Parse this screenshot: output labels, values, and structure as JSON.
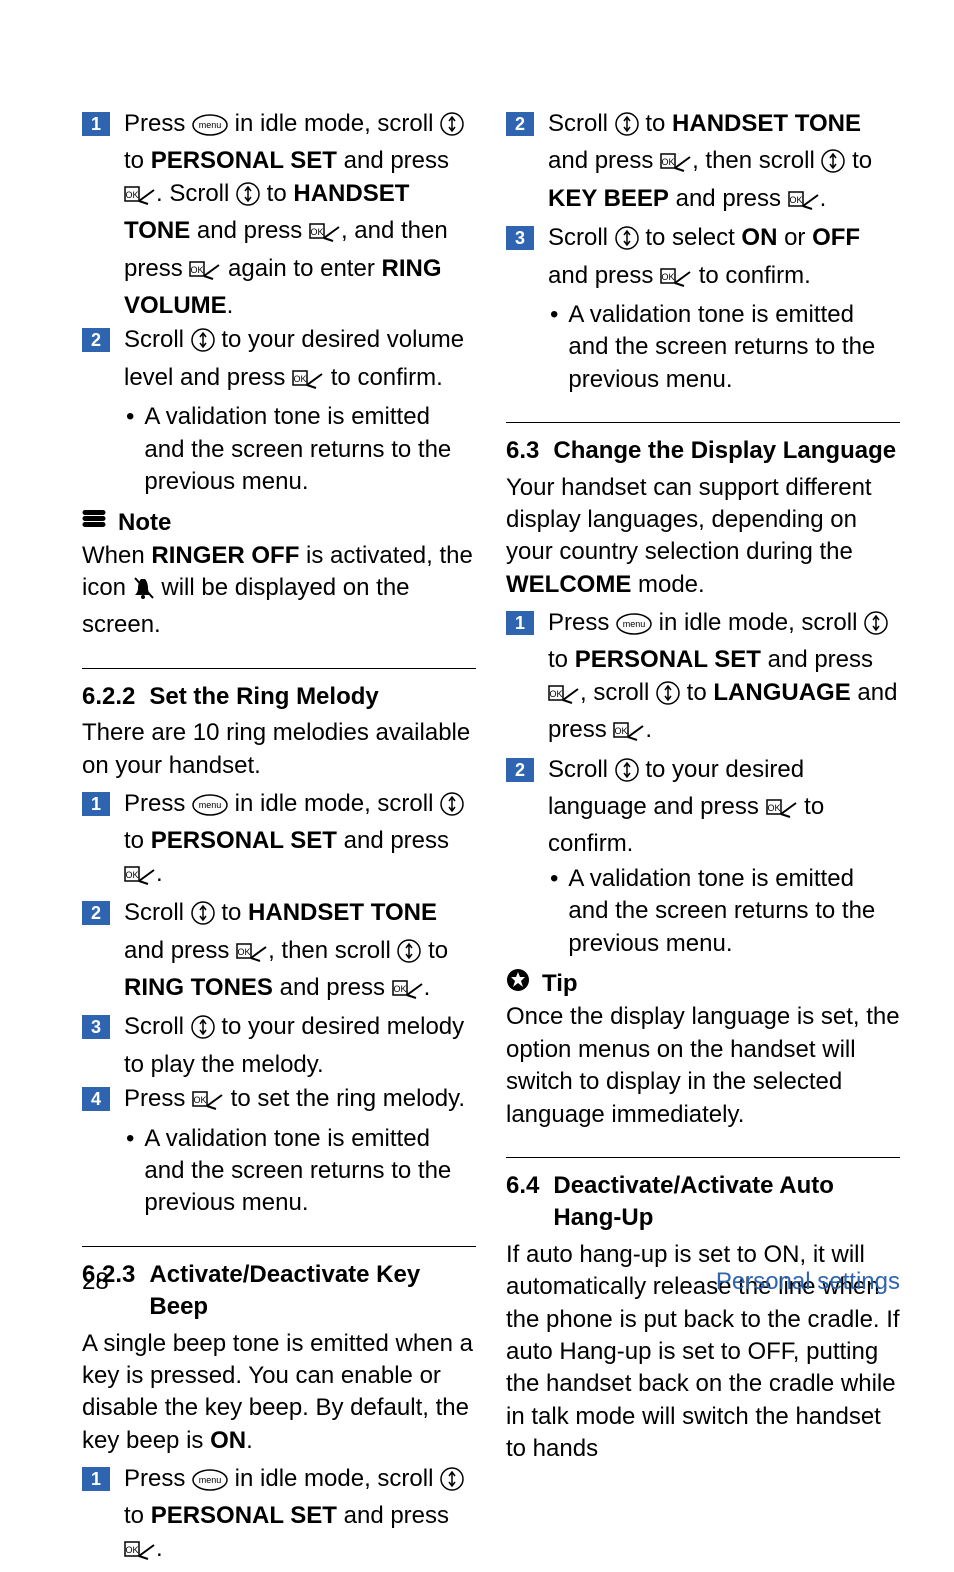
{
  "left": {
    "s1": {
      "a": "Press ",
      "b": " in idle mode, scroll ",
      "c": " to ",
      "d": "PERSONAL SET",
      "e": " and press ",
      "f": ". Scroll ",
      "g": " to ",
      "h": "HANDSET TONE",
      "i": " and press ",
      "j": ", and then press ",
      "k": " again to enter ",
      "l": "RING VOLUME",
      "m": "."
    },
    "s2": {
      "a": "Scroll ",
      "b": " to your desired volume level and press ",
      "c": " to confirm."
    },
    "bullet1": "A validation tone is emitted and the screen returns to the previous menu.",
    "noteLabel": "Note",
    "noteBody1": "When ",
    "noteBody2": "RINGER OFF",
    "noteBody3": " is activated, the icon ",
    "noteBody4": " will be displayed on the screen.",
    "h622num": "6.2.2",
    "h622txt": "Set the Ring Melody",
    "melodyIntro": "There are 10 ring melodies available on your handset.",
    "m1": {
      "a": "Press ",
      "b": " in idle mode, scroll ",
      "c": " to ",
      "d": "PERSONAL SET",
      "e": " and press ",
      "f": "."
    },
    "m2": {
      "a": "Scroll ",
      "b": " to ",
      "c": "HANDSET TONE",
      "d": " and press ",
      "e": ", then scroll ",
      "f": " to ",
      "g": "RING TONES",
      "h": " and press ",
      "i": "."
    },
    "m3": {
      "a": "Scroll ",
      "b": " to your desired melody to play the melody."
    },
    "m4": {
      "a": "Press ",
      "b": " to set the ring melody."
    },
    "bullet2": "A validation tone is emitted and the screen returns to the previous menu.",
    "h623num": "6.2.3",
    "h623txt": "Activate/Deactivate Key Beep",
    "beepIntro1": "A single beep tone is emitted when a key is pressed. You can enable or disable the key beep. By default, the key beep is ",
    "beepIntro2": "ON",
    "beepIntro3": ".",
    "b1": {
      "a": "Press ",
      "b": " in idle mode, scroll ",
      "c": " to ",
      "d": "PERSONAL SET",
      "e": " and press ",
      "f": "."
    }
  },
  "right": {
    "r2": {
      "a": "Scroll ",
      "b": " to ",
      "c": "HANDSET TONE",
      "d": " and press ",
      "e": ", then scroll ",
      "f": " to ",
      "g": "KEY BEEP",
      "h": " and press ",
      "i": "."
    },
    "r3": {
      "a": "Scroll ",
      "b": " to select ",
      "c": "ON",
      "d": " or ",
      "e": "OFF",
      "f": " and press ",
      "g": " to confirm."
    },
    "bullet3": "A validation tone is emitted and the screen returns to the previous menu.",
    "h63num": "6.3",
    "h63txt": "Change the Display Language",
    "langIntro1": "Your handset can support different display languages, depending on your country selection during the ",
    "langIntro2": "WELCOME",
    "langIntro3": " mode.",
    "l1": {
      "a": "Press ",
      "b": " in idle mode, scroll ",
      "c": " to ",
      "d": "PERSONAL SET",
      "e": " and press ",
      "f": ", scroll ",
      "g": " to ",
      "h": "LANGUAGE",
      "i": " and press ",
      "j": "."
    },
    "l2": {
      "a": "Scroll ",
      "b": " to your desired language and press ",
      "c": " to confirm."
    },
    "bullet4": "A validation tone is emitted and the screen returns to the previous menu.",
    "tipLabel": "Tip",
    "tipBody": "Once the display language is set, the option menus on the handset will switch to display in the selected language immediately.",
    "h64num": "6.4",
    "h64txt": "Deactivate/Activate Auto Hang-Up",
    "hangBody": "If auto hang-up is set to ON, it will automatically release the line when the phone is put back to the cradle. If auto Hang-up is set to OFF, putting the handset back on the cradle while in talk mode will switch the handset to hands"
  },
  "footer": {
    "page": "28",
    "section": "Personal settings"
  },
  "nums": {
    "n1": "1",
    "n2": "2",
    "n3": "3",
    "n4": "4"
  }
}
